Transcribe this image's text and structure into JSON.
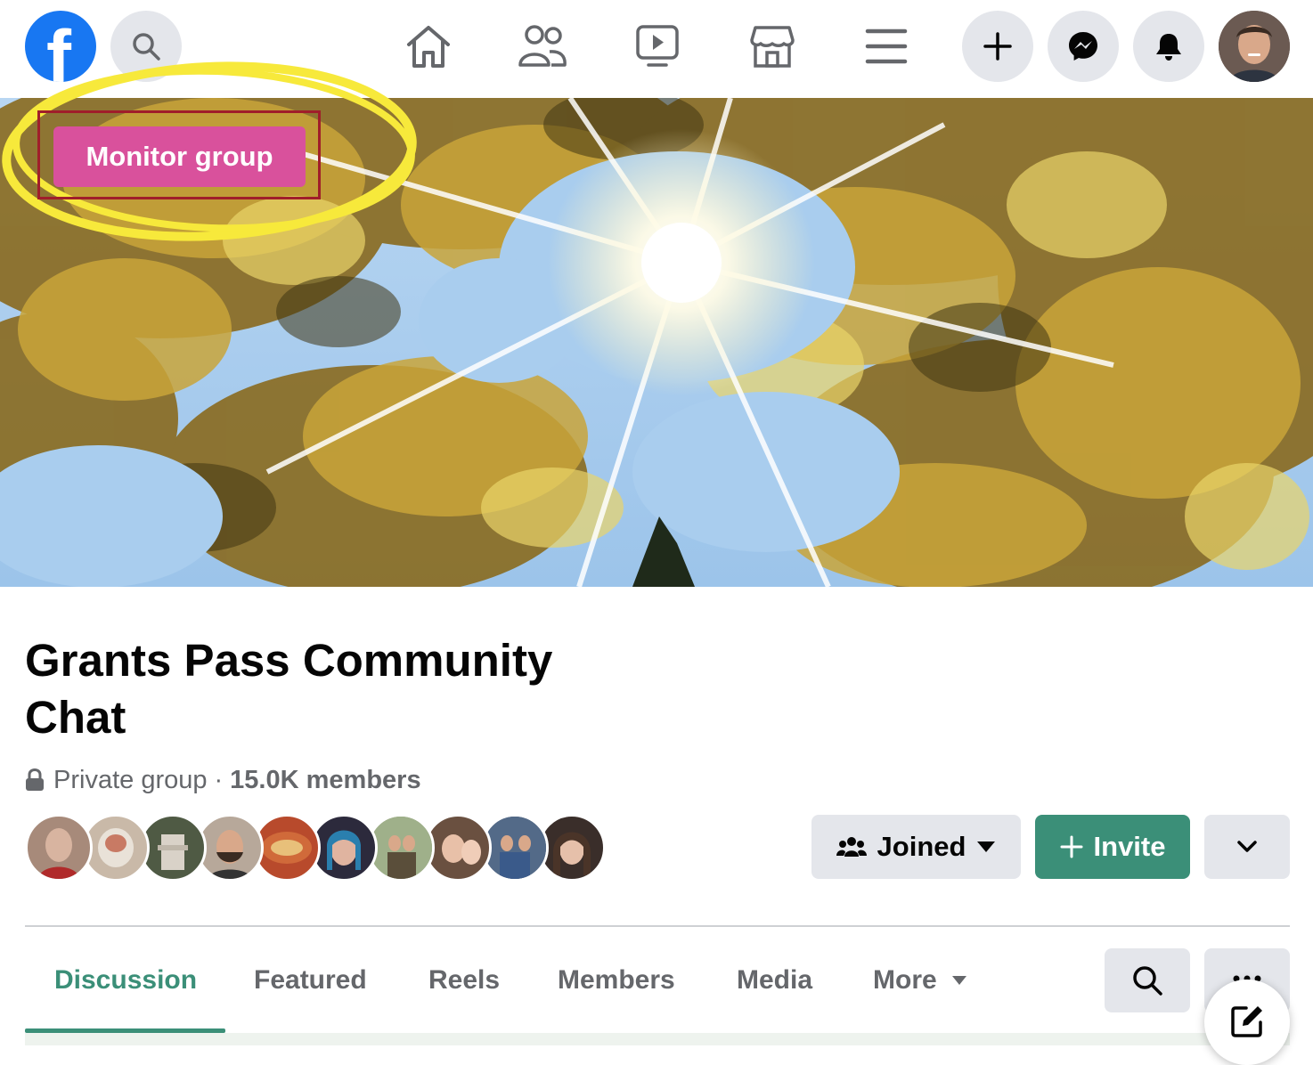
{
  "nav": {
    "logo_letter": "f",
    "icons": [
      "search-icon",
      "home-icon",
      "friends-icon",
      "watch-icon",
      "marketplace-icon",
      "menu-icon",
      "create-icon",
      "messenger-icon",
      "notifications-icon",
      "profile-avatar"
    ]
  },
  "annotation": {
    "monitor_label": "Monitor group",
    "highlight_color": "#f7e93b",
    "box_color": "#a01e2a",
    "button_color": "#d9519c"
  },
  "group": {
    "title": "Grants Pass Community Chat",
    "privacy": "Private group",
    "separator": "·",
    "members": "15.0K members"
  },
  "actions": {
    "joined_label": "Joined",
    "invite_label": "Invite",
    "invite_color": "#3b8f78"
  },
  "tabs": [
    {
      "label": "Discussion",
      "active": true
    },
    {
      "label": "Featured",
      "active": false
    },
    {
      "label": "Reels",
      "active": false
    },
    {
      "label": "Members",
      "active": false
    },
    {
      "label": "Media",
      "active": false
    },
    {
      "label": "More",
      "active": false
    }
  ],
  "colors": {
    "facebook_blue": "#1877f2",
    "accent_green": "#3b8f78",
    "button_gray": "#e4e6eb"
  }
}
